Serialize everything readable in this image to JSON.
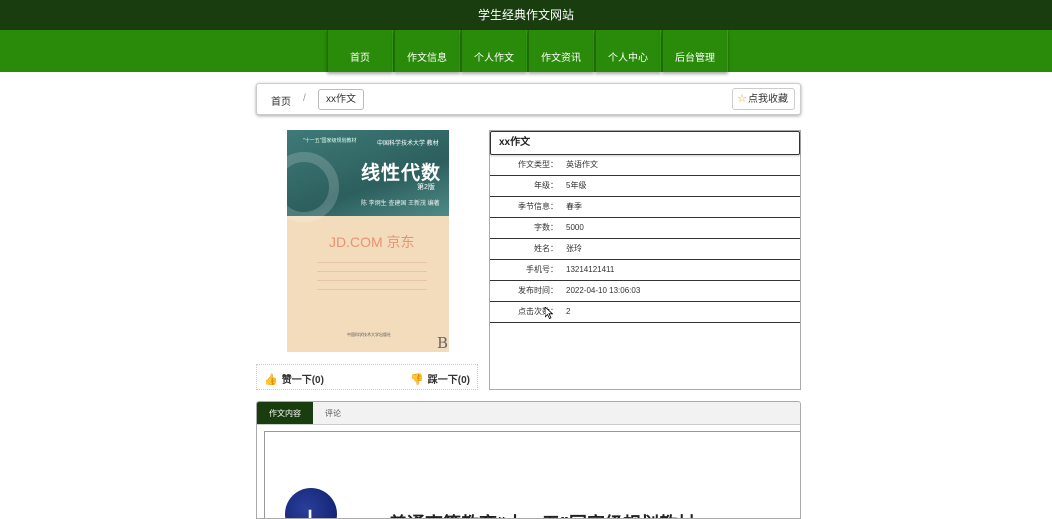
{
  "site": {
    "title": "学生经典作文网站"
  },
  "nav": {
    "items": [
      "首页",
      "作文信息",
      "个人作文",
      "作文资讯",
      "个人中心",
      "后台管理"
    ]
  },
  "breadcrumb": {
    "home": "首页",
    "separator": "/",
    "current": "xx作文"
  },
  "favorite": {
    "label": "点我收藏"
  },
  "cover": {
    "title": "线性代数",
    "edition": "第2版",
    "series_small": "\"十一五\"国家级规划教材",
    "tagline": "中国科学技术大学 教材",
    "authors": "陈 李炯生 查建国 王新茂 编著",
    "watermark": "JD.COM 京东",
    "publisher": "中国科学技术大学出版社",
    "corner_mark": "B"
  },
  "votes": {
    "like_label": "赞一下(0)",
    "dislike_label": "踩一下(0)"
  },
  "info": {
    "title": "xx作文",
    "rows": [
      {
        "key": "作文类型：",
        "value": "英语作文"
      },
      {
        "key": "年级：",
        "value": "5年级"
      },
      {
        "key": "季节信息：",
        "value": "春季"
      },
      {
        "key": "字数：",
        "value": "5000"
      },
      {
        "key": "姓名：",
        "value": "张玲"
      },
      {
        "key": "手机号：",
        "value": "13214121411"
      },
      {
        "key": "发布时间：",
        "value": "2022-04-10 13:06:03"
      },
      {
        "key": "点击次数：",
        "value": "2"
      }
    ]
  },
  "tabs": {
    "items": [
      "作文内容",
      "评论"
    ],
    "active": 0
  },
  "content": {
    "logo_text": "十",
    "heading": "普通高等教育“十一五”国家级规划教材"
  },
  "colors": {
    "topbar": "#1a3d10",
    "nav": "#2a8a09",
    "accent_red": "#d9363e"
  }
}
